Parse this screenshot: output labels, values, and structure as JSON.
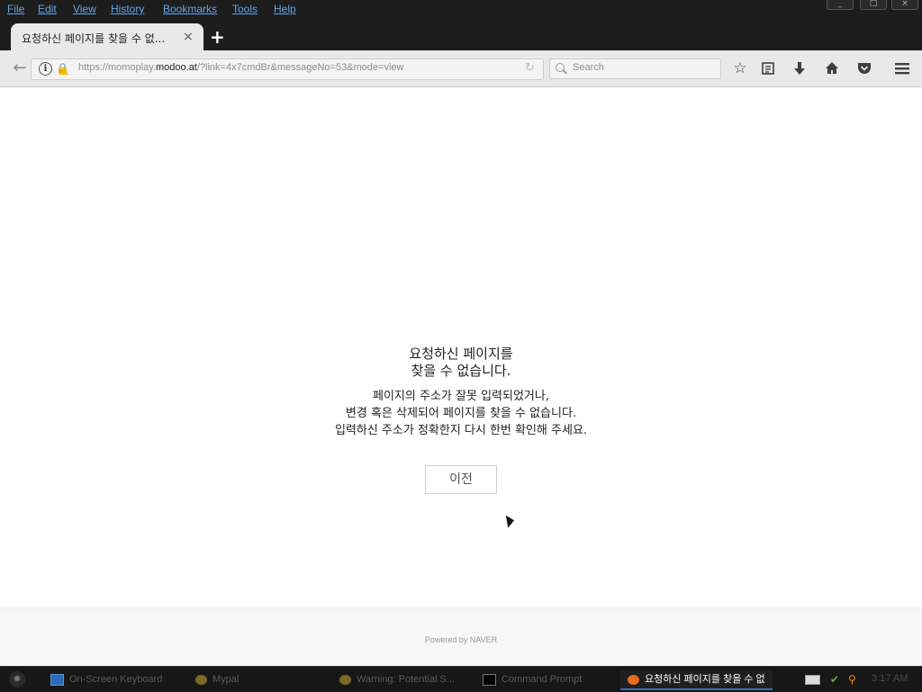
{
  "menu": {
    "items": [
      "File",
      "Edit",
      "View",
      "History",
      "Bookmarks",
      "Tools",
      "Help"
    ]
  },
  "window_controls": {
    "minimize": "_",
    "maximize": "□",
    "close": "×"
  },
  "tab": {
    "title": "요청하신 페이지를 찾을 수 없...",
    "close": "×",
    "new_tab": "+"
  },
  "urlbar": {
    "prefix": "https://momoplay.",
    "host": "modoo.at",
    "suffix": "/?link=4x7cmdBr&messageNo=53&mode=view"
  },
  "search": {
    "placeholder": "Search"
  },
  "toolbar_icons": [
    "star-icon",
    "reader-list-icon",
    "download-icon",
    "home-icon",
    "pocket-icon",
    "hamburger-menu-icon"
  ],
  "page": {
    "title_line1": "요청하신 페이지를",
    "title_line2": "찾을 수 없습니다.",
    "desc_line1": "페이지의 주소가 잘못 입력되었거나,",
    "desc_line2": "변경 혹은 삭제되어 페이지를 찾을 수 없습니다.",
    "desc_line3": "입력하신 주소가 정확한지 다시 한번 확인해 주세요.",
    "prev_button": "이전",
    "footer": "Powered by NAVER"
  },
  "taskbar": {
    "tasks": [
      {
        "label": "On-Screen Keyboard",
        "active": false
      },
      {
        "label": "Mypal",
        "active": false
      },
      {
        "label": "Warning: Potential S...",
        "active": false
      },
      {
        "label": "Command Prompt",
        "active": false
      },
      {
        "label": "요청하신 페이지를 찾을 수 없",
        "active": true
      }
    ],
    "clock": "3:17 AM"
  },
  "colors": {
    "menu_text": "#62a6e8",
    "chrome_dark": "#1d1d1d",
    "toolbar": "#e9e9e9",
    "active_task_underline": "#2e6fbd",
    "warning": "#f0c000"
  }
}
